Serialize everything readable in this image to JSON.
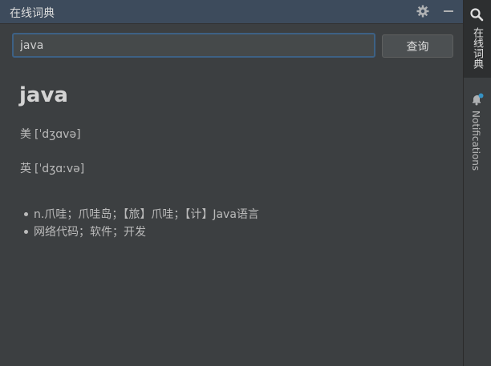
{
  "window": {
    "title": "在线词典"
  },
  "icons": {
    "settings": "gear-icon",
    "minimize": "minimize-icon",
    "dictionary": "search-icon",
    "notifications": "bell-icon"
  },
  "search": {
    "value": "java",
    "placeholder": "",
    "button_label": "查询"
  },
  "result": {
    "word": "java",
    "phonetics": [
      {
        "label": "美",
        "text": "[ˈdʒɑvə]"
      },
      {
        "label": "英",
        "text": "[ˈdʒɑːvə]"
      }
    ],
    "definitions": [
      "n.爪哇；爪哇岛；【旅】爪哇；【计】Java语言",
      "网络代码；软件；开发"
    ]
  },
  "side_stripe": {
    "dictionary_tab": "在线词典",
    "notifications_tab": "Notifications"
  },
  "colors": {
    "background": "#3c3f41",
    "header": "#3d4b5c",
    "input_border": "#3d6185",
    "notification_dot": "#3592c4"
  }
}
